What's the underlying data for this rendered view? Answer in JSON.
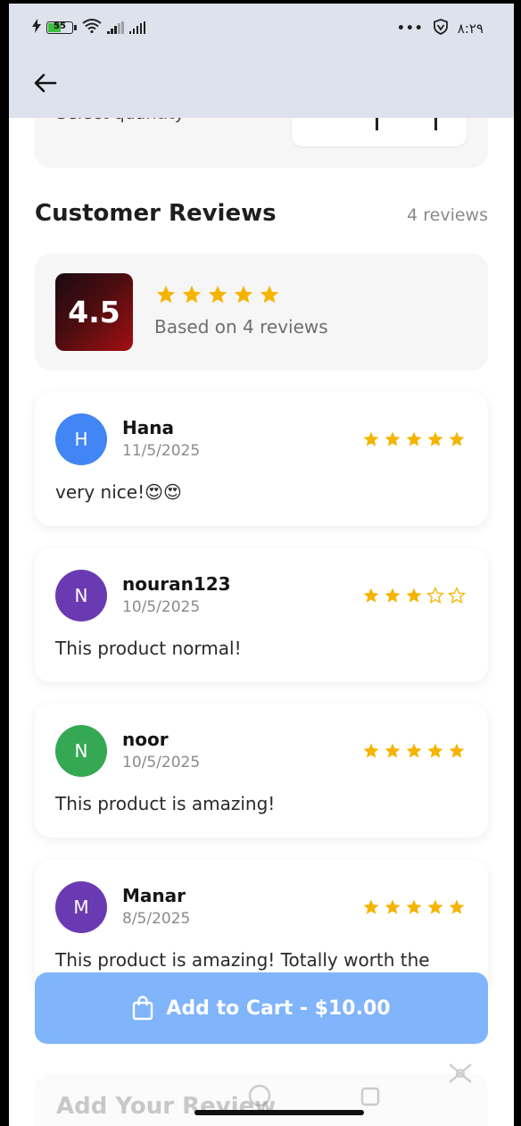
{
  "status_bar": {
    "battery_level": "55",
    "time": "٨:٢٩",
    "more_dots": "•••"
  },
  "quantity": {
    "label": "Select quantity"
  },
  "reviews_section": {
    "title": "Customer Reviews",
    "count_text": "4 reviews"
  },
  "summary": {
    "average": "4.5",
    "stars_filled": 5,
    "based_on_text": "Based on 4 reviews"
  },
  "reviews": [
    {
      "initial": "H",
      "name": "Hana",
      "date": "11/5/2025",
      "rating": 5,
      "text": "very nice!😍😍",
      "avatar_color": "#4285f4"
    },
    {
      "initial": "N",
      "name": "nouran123",
      "date": "10/5/2025",
      "rating": 3,
      "text": "This product normal!",
      "avatar_color": "#6a3ab2"
    },
    {
      "initial": "N",
      "name": "noor",
      "date": "10/5/2025",
      "rating": 5,
      "text": "This product is amazing!",
      "avatar_color": "#34a853"
    },
    {
      "initial": "M",
      "name": "Manar",
      "date": "8/5/2025",
      "rating": 5,
      "text": "This product is amazing! Totally worth the",
      "avatar_color": "#6a3ab2"
    }
  ],
  "cart_button": {
    "label": "Add to Cart - $10.00",
    "color": "#80b4fb"
  },
  "add_review": {
    "title": "Add Your Review"
  },
  "colors": {
    "star": "#f5b400",
    "app_bar": "#dde2ec"
  }
}
